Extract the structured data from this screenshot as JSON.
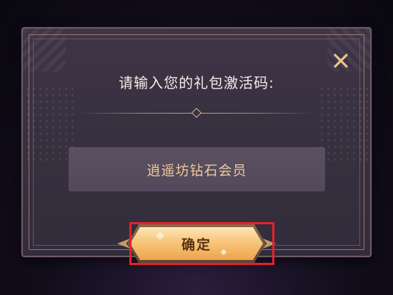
{
  "dialog": {
    "prompt": "请输入您的礼包激活码:",
    "code_value": "逍遥坊钻石会员",
    "confirm_label": "确定",
    "close_icon": "close-icon"
  },
  "colors": {
    "accent_gold": "#f0c89a",
    "button_fill": "#f7c57c",
    "highlight_red": "#e8202a",
    "panel_bg": "#3a3240"
  }
}
